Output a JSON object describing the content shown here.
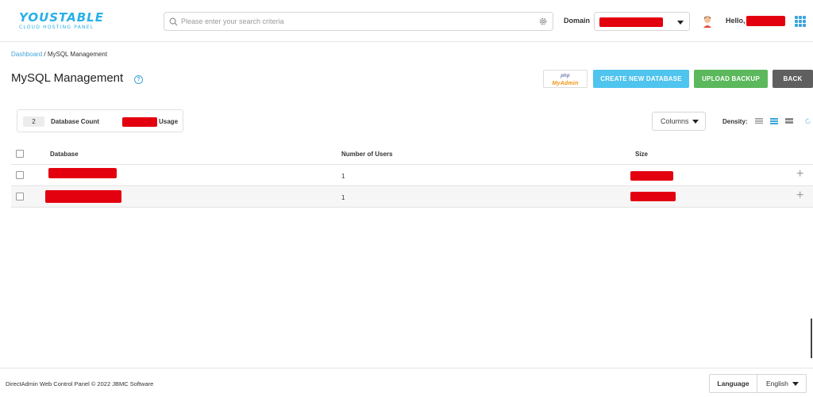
{
  "header": {
    "logo_main": "YOUSTABLE",
    "logo_sub": "CLOUD HOSTING PANEL",
    "search_placeholder": "Please enter your search criteria",
    "domain_label": "Domain",
    "hello_label": "Hello,"
  },
  "breadcrumb": {
    "home": "Dashboard",
    "separator": " / ",
    "current": "MySQL Management"
  },
  "page": {
    "title": "MySQL Management",
    "help_glyph": "?"
  },
  "buttons": {
    "phpmyadmin_top": "php",
    "phpmyadmin_bottom": "MyAdmin",
    "create": "CREATE NEW DATABASE",
    "upload": "UPLOAD BACKUP",
    "back": "BACK"
  },
  "stats": {
    "count": "2",
    "count_label": "Database Count",
    "usage_label": "Usage"
  },
  "toolbar": {
    "columns_label": "Columns",
    "density_label": "Density:"
  },
  "table": {
    "headers": [
      "Database",
      "Number of Users",
      "Size"
    ],
    "rows": [
      {
        "users": "1"
      },
      {
        "users": "1"
      }
    ]
  },
  "footer": {
    "copyright": "DirectAdmin Web Control Panel © 2022 JBMC Software",
    "language_label": "Language",
    "language_value": "English"
  },
  "colors": {
    "accent_blue": "#4fc4ee",
    "success_green": "#5cb85c",
    "back_gray": "#5f5f5f",
    "redaction": "#e3000f"
  }
}
